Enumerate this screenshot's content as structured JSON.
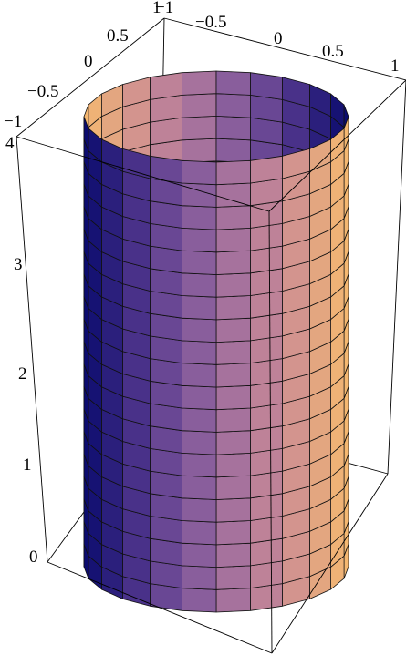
{
  "plot": {
    "x_ticks": [
      "−1",
      "−0.5",
      "0",
      "0.5",
      "1"
    ],
    "y_ticks": [
      "−1",
      "−0.5",
      "0",
      "0.5",
      "1"
    ],
    "z_ticks": [
      "0",
      "1",
      "2",
      "3",
      "4"
    ],
    "surface": {
      "shape": "cylinder",
      "radius": 1,
      "z_range": [
        0,
        4
      ],
      "angular_segments": 24,
      "height_segments": 20,
      "colors": [
        "#0a0a6e",
        "#5a3c90",
        "#9a6aa0",
        "#c98a96",
        "#f6b970"
      ]
    }
  }
}
